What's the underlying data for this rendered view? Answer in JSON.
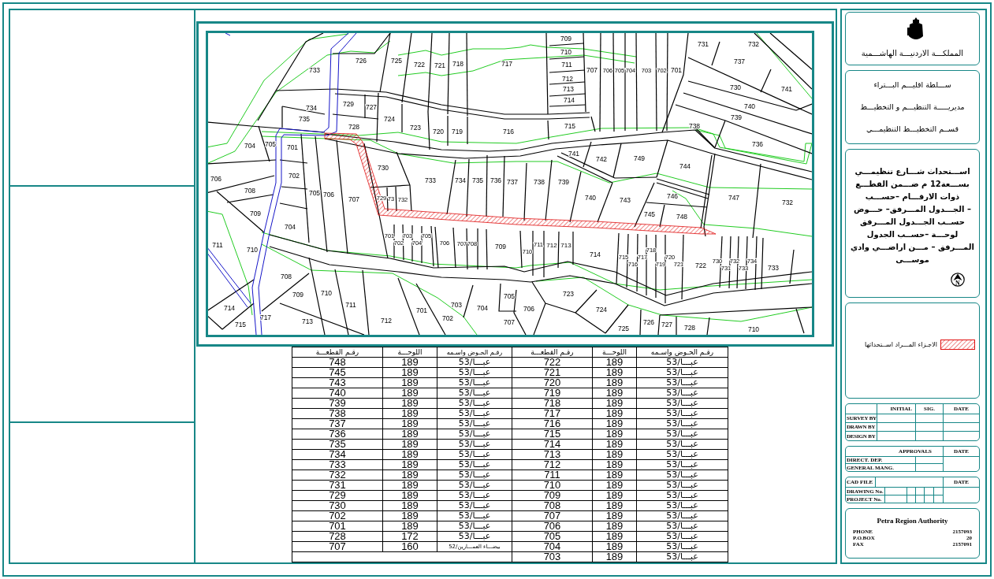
{
  "map": {
    "parcel_labels": [
      "709",
      "731",
      "732",
      "710",
      "726",
      "725",
      "722",
      "721",
      "718",
      "717",
      "711",
      "737",
      "733",
      "707",
      "706",
      "705",
      "704",
      "703",
      "702",
      "701",
      "712",
      "713",
      "730",
      "741",
      "734",
      "729",
      "727",
      "714",
      "740",
      "735",
      "724",
      "739",
      "728",
      "723",
      "720",
      "719",
      "716",
      "715",
      "738",
      "704",
      "705",
      "701",
      "736",
      "741",
      "742",
      "749",
      "730",
      "744",
      "706",
      "702",
      "733",
      "734",
      "735",
      "736",
      "737",
      "738",
      "739",
      "708",
      "705",
      "706",
      "707",
      "729",
      "73",
      "732",
      "740",
      "743",
      "746",
      "747",
      "732",
      "709",
      "745",
      "748",
      "704",
      "701",
      "703",
      "705",
      "711",
      "710",
      "702",
      "704",
      "706",
      "707",
      "708",
      "709",
      "710",
      "711",
      "712",
      "713",
      "714",
      "715",
      "716",
      "717",
      "718",
      "719",
      "720",
      "721",
      "722",
      "730",
      "731",
      "732",
      "733",
      "734",
      "733",
      "708",
      "709",
      "710",
      "705",
      "723",
      "714",
      "711",
      "701",
      "703",
      "704",
      "706",
      "724",
      "715",
      "717",
      "713",
      "712",
      "702",
      "707",
      "725",
      "726",
      "727",
      "728",
      "710"
    ]
  },
  "parcel_table": {
    "groups": [
      {
        "columns": [
          "رقـم القطعـــة",
          "اللوحـــة",
          "رقـم الحـوض واسـمه"
        ],
        "rows": [
          [
            "722",
            "189",
            "عبـــا/53"
          ],
          [
            "721",
            "189",
            "عبـــا/53"
          ],
          [
            "720",
            "189",
            "عبـــا/53"
          ],
          [
            "719",
            "189",
            "عبـــا/53"
          ],
          [
            "718",
            "189",
            "عبـــا/53"
          ],
          [
            "717",
            "189",
            "عبـــا/53"
          ],
          [
            "716",
            "189",
            "عبـــا/53"
          ],
          [
            "715",
            "189",
            "عبـــا/53"
          ],
          [
            "714",
            "189",
            "عبـــا/53"
          ],
          [
            "713",
            "189",
            "عبـــا/53"
          ],
          [
            "712",
            "189",
            "عبـــا/53"
          ],
          [
            "711",
            "189",
            "عبـــا/53"
          ],
          [
            "710",
            "189",
            "عبـــا/53"
          ],
          [
            "709",
            "189",
            "عبـــا/53"
          ],
          [
            "708",
            "189",
            "عبـــا/53"
          ],
          [
            "707",
            "189",
            "عبـــا/53"
          ],
          [
            "706",
            "189",
            "عبـــا/53"
          ],
          [
            "705",
            "189",
            "عبـــا/53"
          ],
          [
            "704",
            "189",
            "عبـــا/53"
          ],
          [
            "703",
            "189",
            "عبـــا/53"
          ]
        ]
      },
      {
        "columns": [
          "رقـم القطعـــة",
          "اللوحـــة",
          "رقـم الحـوض واسـمه"
        ],
        "rows": [
          [
            "748",
            "189",
            "عبـــا/53"
          ],
          [
            "745",
            "189",
            "عبـــا/53"
          ],
          [
            "743",
            "189",
            "عبـــا/53"
          ],
          [
            "740",
            "189",
            "عبـــا/53"
          ],
          [
            "739",
            "189",
            "عبـــا/53"
          ],
          [
            "738",
            "189",
            "عبـــا/53"
          ],
          [
            "737",
            "189",
            "عبـــا/53"
          ],
          [
            "736",
            "189",
            "عبـــا/53"
          ],
          [
            "735",
            "189",
            "عبـــا/53"
          ],
          [
            "734",
            "189",
            "عبـــا/53"
          ],
          [
            "733",
            "189",
            "عبـــا/53"
          ],
          [
            "732",
            "189",
            "عبـــا/53"
          ],
          [
            "731",
            "189",
            "عبـــا/53"
          ],
          [
            "729",
            "189",
            "عبـــا/53"
          ],
          [
            "730",
            "189",
            "عبـــا/53"
          ],
          [
            "702",
            "189",
            "عبـــا/53"
          ],
          [
            "701",
            "189",
            "عبـــا/53"
          ],
          [
            "728",
            "172",
            "عبـــا/53"
          ],
          [
            "707",
            "160",
            "بيضـــاء العمـــارين/52"
          ]
        ]
      }
    ]
  },
  "title_block": {
    "country": "المملكـــة الاردنيـــة الهاشـــمية",
    "authority_lines": [
      "ســـلطة اقليـــم البـــتراء",
      "مديريـــــة التنظيـــم و التخطيـــط",
      "قســم التخطيـــط التنظيمـــي"
    ],
    "project_title": [
      "اســـتحداث شـــارع تنظيمـــي",
      "بســـعة12 م ضـــمن القطـــع",
      "ذوات الارقـــام –حســـب",
      "– الجـــدول المـــرفق– حـــوض",
      "حســب الجـــدول المـــرفق",
      "لوحـــة –حســب الجدول",
      "المـــرفق – مـــن اراضـــي وادي",
      "موســـى"
    ],
    "north_arrow": {
      "letter": "N"
    },
    "legend": {
      "label": "الاجـزاء المـــراد اســتحداثها"
    },
    "signature_table": {
      "columns": [
        "INITIAL",
        "SIG.",
        "DATE"
      ],
      "rows": [
        "SURVEY BY",
        "DRAWN BY",
        "DESIGN BY"
      ]
    },
    "approvals": {
      "header": "APPROVALS",
      "date": "DATE",
      "rows": [
        "DIRECT. DEP.",
        "GENERAL MANG."
      ]
    },
    "file_table": {
      "cad_file": "CAD FILE",
      "date": "DATE",
      "rows": [
        "DRAWING No.",
        "PROJECT No."
      ]
    },
    "contact": {
      "name": "Petra Region Authority",
      "fields": [
        {
          "label": "PHONE",
          "value": "2157093"
        },
        {
          "label": "P.O.BOX",
          "value": "20"
        },
        {
          "label": "FAX",
          "value": "2157091"
        }
      ]
    }
  }
}
